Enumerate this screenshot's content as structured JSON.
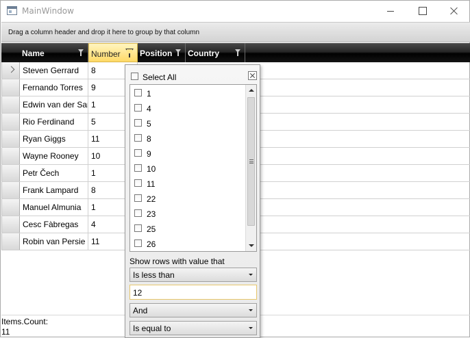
{
  "window": {
    "title": "MainWindow"
  },
  "grid": {
    "group_panel_text": "Drag a column header and drop it here to group by that column",
    "columns": [
      {
        "label": "Name"
      },
      {
        "label": "Number"
      },
      {
        "label": "Position"
      },
      {
        "label": "Country"
      }
    ],
    "rows": [
      {
        "name": "Steven Gerrard",
        "number": "8"
      },
      {
        "name": "Fernando Torres",
        "number": "9"
      },
      {
        "name": "Edwin van der Sar",
        "number": "1"
      },
      {
        "name": "Rio Ferdinand",
        "number": "5"
      },
      {
        "name": "Ryan Giggs",
        "number": "11"
      },
      {
        "name": "Wayne Rooney",
        "number": "10"
      },
      {
        "name": "Petr Čech",
        "number": "1"
      },
      {
        "name": "Frank Lampard",
        "number": "8"
      },
      {
        "name": "Manuel Almunia",
        "number": "1"
      },
      {
        "name": "Cesc Fàbregas",
        "number": "4"
      },
      {
        "name": "Robin van Persie",
        "number": "11"
      }
    ]
  },
  "status": {
    "label": "Items.Count:",
    "value": "11"
  },
  "filter_popup": {
    "select_all_label": "Select All",
    "values": [
      "1",
      "4",
      "5",
      "8",
      "9",
      "10",
      "11",
      "22",
      "23",
      "25",
      "26"
    ],
    "show_rows_label": "Show rows with value that",
    "operator1": "Is less than",
    "value1": "12",
    "logical_operator": "And",
    "operator2": "Is equal to"
  },
  "colors": {
    "header_bg": "#000000",
    "active_header_bg": "#ffd966",
    "input_border": "#e7c66b"
  }
}
